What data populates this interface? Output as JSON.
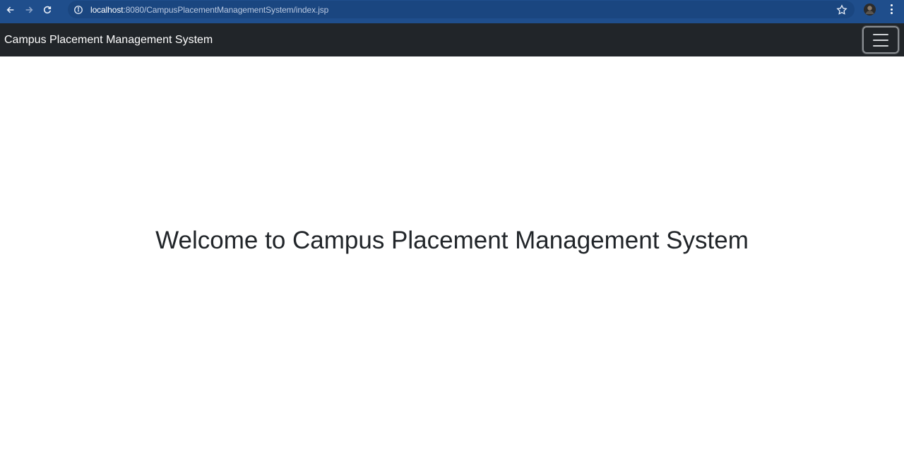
{
  "browser": {
    "url_host": "localhost",
    "url_rest": ":8080/CampusPlacementManagementSystem/index.jsp"
  },
  "icons": {
    "back": "back-arrow-icon",
    "forward": "forward-arrow-icon",
    "reload": "reload-icon",
    "site_info": "info-icon",
    "bookmark": "star-icon",
    "profile": "avatar",
    "menu": "kebab-menu-icon",
    "toggler": "hamburger-icon"
  },
  "navbar": {
    "brand": "Campus Placement Management System"
  },
  "main": {
    "heading": "Welcome to Campus Placement Management System"
  },
  "colors": {
    "browser_chrome": "#1f4e8c",
    "navbar_bg": "#212529",
    "heading_text": "#212529"
  }
}
